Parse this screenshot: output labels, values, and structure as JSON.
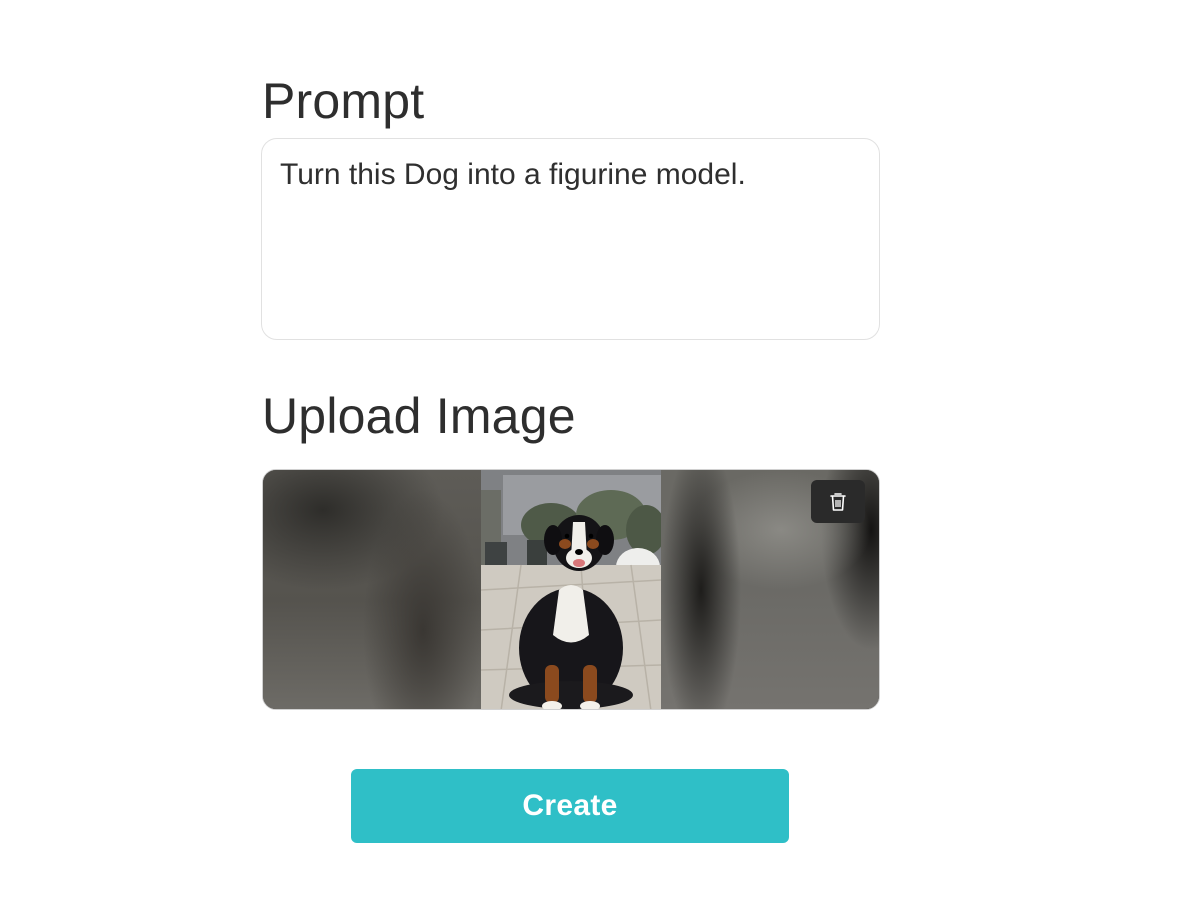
{
  "prompt": {
    "title": "Prompt",
    "value": "Turn this Dog into a figurine model."
  },
  "upload": {
    "title": "Upload Image",
    "image_subject": "Bernese mountain dog sitting on a stone patio",
    "delete_icon": "trash-icon"
  },
  "actions": {
    "create_label": "Create"
  },
  "colors": {
    "accent": "#2fbfc7",
    "text": "#2e2e2e",
    "delete_button_bg": "#2a2a2a"
  }
}
